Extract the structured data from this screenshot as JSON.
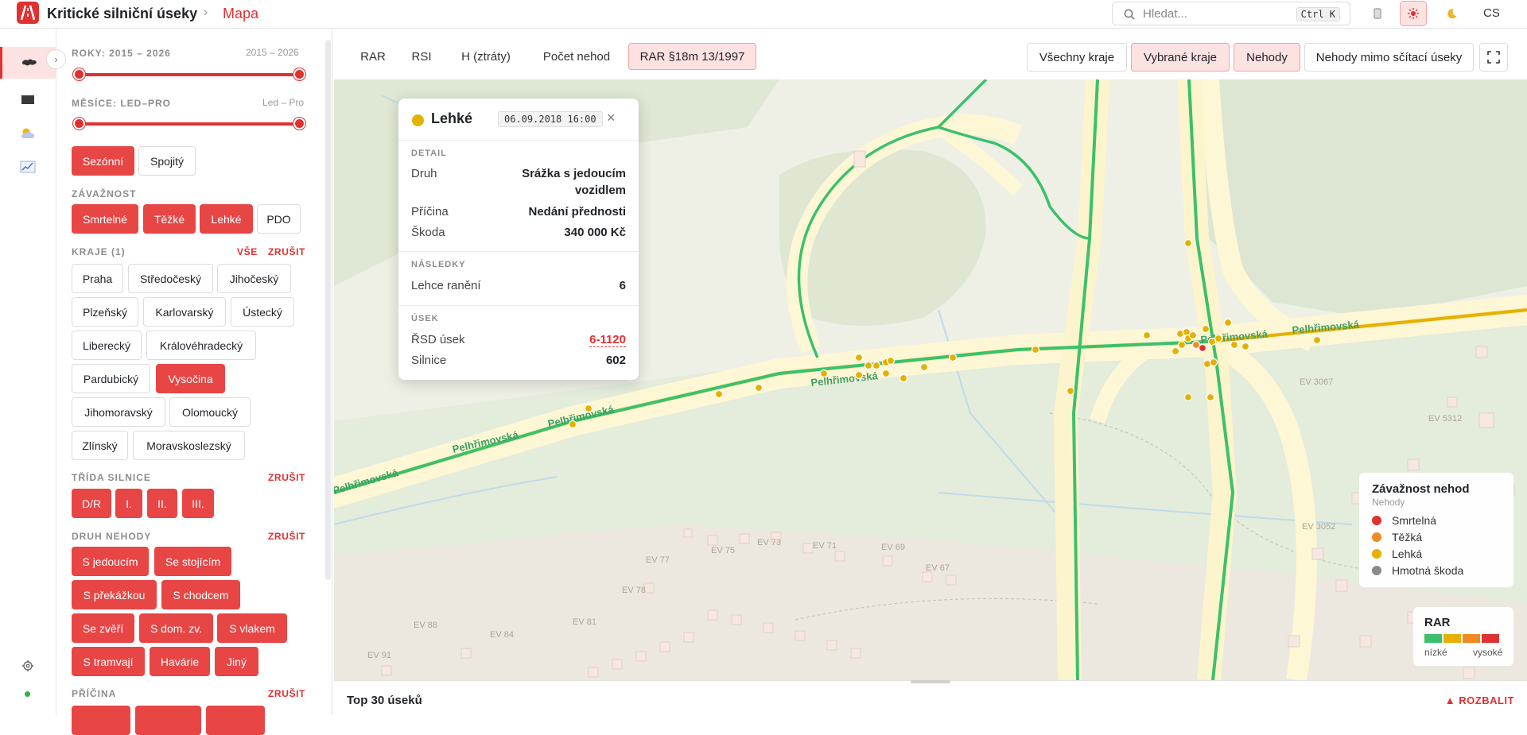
{
  "header": {
    "app_title": "Kritické silniční úseky",
    "breadcrumb_sep": "›",
    "breadcrumb_current": "Mapa",
    "search_placeholder": "Hledat...",
    "search_shortcut": "Ctrl K",
    "language": "CS",
    "brand_color": "#e03131"
  },
  "rail": {
    "items": [
      "map-icon",
      "table-icon",
      "weather-icon",
      "chart-icon"
    ],
    "settings_icon": "gear-icon",
    "status_color": "#2fb344"
  },
  "filters": {
    "years": {
      "label": "ROKY: 2015 – 2026",
      "range_text": "2015 – 2026"
    },
    "months": {
      "label": "MĚSÍCE: LED–PRO",
      "range_text": "Led – Pro"
    },
    "mode": {
      "seasonal": "Sezónní",
      "continuous": "Spojitý"
    },
    "severity": {
      "label": "ZÁVAŽNOST",
      "options": [
        "Smrtelné",
        "Těžké",
        "Lehké",
        "PDO"
      ]
    },
    "regions": {
      "label": "KRAJE (1)",
      "all": "VŠE",
      "clear": "ZRUŠIT",
      "options": [
        "Praha",
        "Středočeský",
        "Jihočeský",
        "Plzeňský",
        "Karlovarský",
        "Ústecký",
        "Liberecký",
        "Královéhradecký",
        "Pardubický",
        "Vysočina",
        "Jihomoravský",
        "Olomoucký",
        "Zlínský",
        "Moravskoslezský"
      ]
    },
    "road_class": {
      "label": "TŘÍDA SILNICE",
      "clear": "ZRUŠIT",
      "options": [
        "D/R",
        "I.",
        "II.",
        "III."
      ]
    },
    "accident_type": {
      "label": "DRUH NEHODY",
      "clear": "ZRUŠIT",
      "options": [
        "S jedoucím",
        "Se stojícím",
        "S překážkou",
        "S chodcem",
        "Se zvěří",
        "S dom. zv.",
        "S vlakem",
        "S tramvají",
        "Havárie",
        "Jiný"
      ]
    },
    "cause": {
      "label": "PŘÍČINA",
      "clear": "ZRUŠIT"
    }
  },
  "map_tabs": {
    "metrics": [
      "RAR",
      "RSI",
      "H (ztráty)",
      "Počet nehod",
      "RAR §18m 13/1997"
    ],
    "scopes": [
      "Všechny kraje",
      "Vybrané kraje",
      "Nehody",
      "Nehody mimo sčítací úseky"
    ]
  },
  "map_labels": {
    "streets": [
      "Pelhřimovská",
      "Pelhřimovská",
      "Pelhřimovská",
      "Pelhřimovská",
      "Pelhřimovská",
      "Pelhřimovská"
    ],
    "addresses": [
      "EV 3067",
      "EV 5312",
      "EV 3052",
      "EV 77",
      "EV 75",
      "EV 73",
      "EV 71",
      "EV 69",
      "EV 67",
      "EV 78",
      "EV 88",
      "EV 84",
      "EV 81",
      "EV 91"
    ]
  },
  "popup": {
    "title": "Lehké",
    "date": "06.09.2018 16:00",
    "close": "×",
    "detail_label": "DETAIL",
    "type_key": "Druh",
    "type_val_line1": "Srážka s jedoucím",
    "type_val_line2": "vozidlem",
    "cause_key": "Příčina",
    "cause_val": "Nedání přednosti",
    "damage_key": "Škoda",
    "damage_val": "340 000 Kč",
    "consequences_label": "NÁSLEDKY",
    "injury_key": "Lehce ranění",
    "injury_val": "6",
    "segment_label": "ÚSEK",
    "rsd_key": "ŘSD úsek",
    "rsd_val": "6-1120",
    "road_key": "Silnice",
    "road_val": "602",
    "severity_color": "#e5b000"
  },
  "legend": {
    "title": "Závažnost nehod",
    "subtitle": "Nehody",
    "items": [
      {
        "label": "Smrtelná",
        "color": "#e03131"
      },
      {
        "label": "Těžká",
        "color": "#f08a24"
      },
      {
        "label": "Lehká",
        "color": "#e5b000"
      },
      {
        "label": "Hmotná škoda",
        "color": "#8a8a8a"
      }
    ]
  },
  "rar_legend": {
    "title": "RAR",
    "low": "nízké",
    "high": "vysoké",
    "colors": [
      "#3cc06b",
      "#e5b000",
      "#f08a24",
      "#e03131"
    ]
  },
  "bottom": {
    "title": "Top 30 úseků",
    "expand": "▲ ROZBALIT"
  }
}
